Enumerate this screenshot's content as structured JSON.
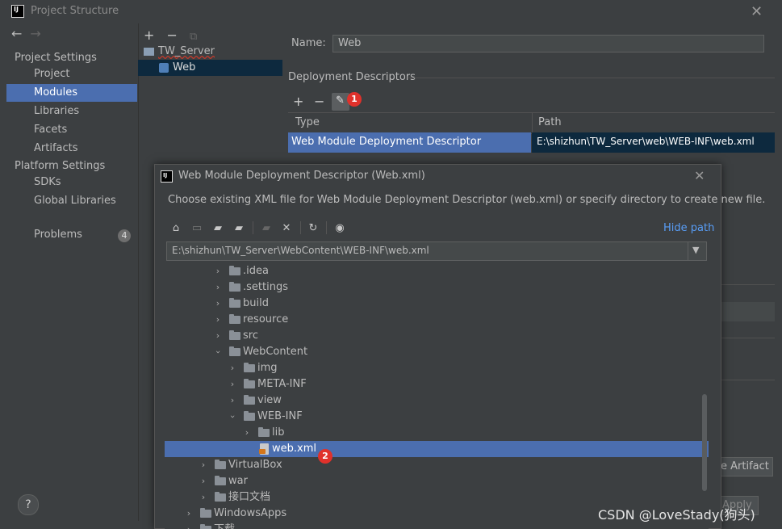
{
  "window": {
    "title": "Project Structure"
  },
  "sidebar": {
    "section1": "Project Settings",
    "items1": [
      {
        "label": "Project"
      },
      {
        "label": "Modules"
      },
      {
        "label": "Libraries"
      },
      {
        "label": "Facets"
      },
      {
        "label": "Artifacts"
      }
    ],
    "section2": "Platform Settings",
    "items2": [
      {
        "label": "SDKs"
      },
      {
        "label": "Global Libraries"
      }
    ],
    "problems_label": "Problems",
    "problems_count": "4"
  },
  "modules": {
    "project_name": "TW_Server",
    "module_name": "Web"
  },
  "detail": {
    "name_label": "Name:",
    "name_value": "Web",
    "dd_section": "Deployment Descriptors",
    "col_type": "Type",
    "col_path": "Path",
    "row_type": "Web Module Deployment Descriptor",
    "row_path": "E:\\shizhun\\TW_Server\\web\\WEB-INF\\web.xml",
    "step1": "1",
    "artifact_btn_partial": "e Artifact",
    "apply_partial": "Apply"
  },
  "dialog": {
    "title": "Web Module Deployment Descriptor (Web.xml)",
    "description": "Choose existing XML file for Web Module Deployment Descriptor (web.xml) or specify directory to create new file.",
    "hide_path": "Hide path",
    "path_value": "E:\\shizhun\\TW_Server\\WebContent\\WEB-INF\\web.xml",
    "step2": "2",
    "tree": [
      {
        "label": ".idea"
      },
      {
        "label": ".settings"
      },
      {
        "label": "build"
      },
      {
        "label": "resource"
      },
      {
        "label": "src"
      },
      {
        "label": "WebContent"
      },
      {
        "label": "img"
      },
      {
        "label": "META-INF"
      },
      {
        "label": "view"
      },
      {
        "label": "WEB-INF"
      },
      {
        "label": "lib"
      },
      {
        "label": "web.xml"
      },
      {
        "label": "VirtualBox"
      },
      {
        "label": "war"
      },
      {
        "label": "接口文档"
      },
      {
        "label": "WindowsApps"
      },
      {
        "label": "下载"
      }
    ]
  },
  "watermark": "CSDN @LoveStady(狗头)"
}
